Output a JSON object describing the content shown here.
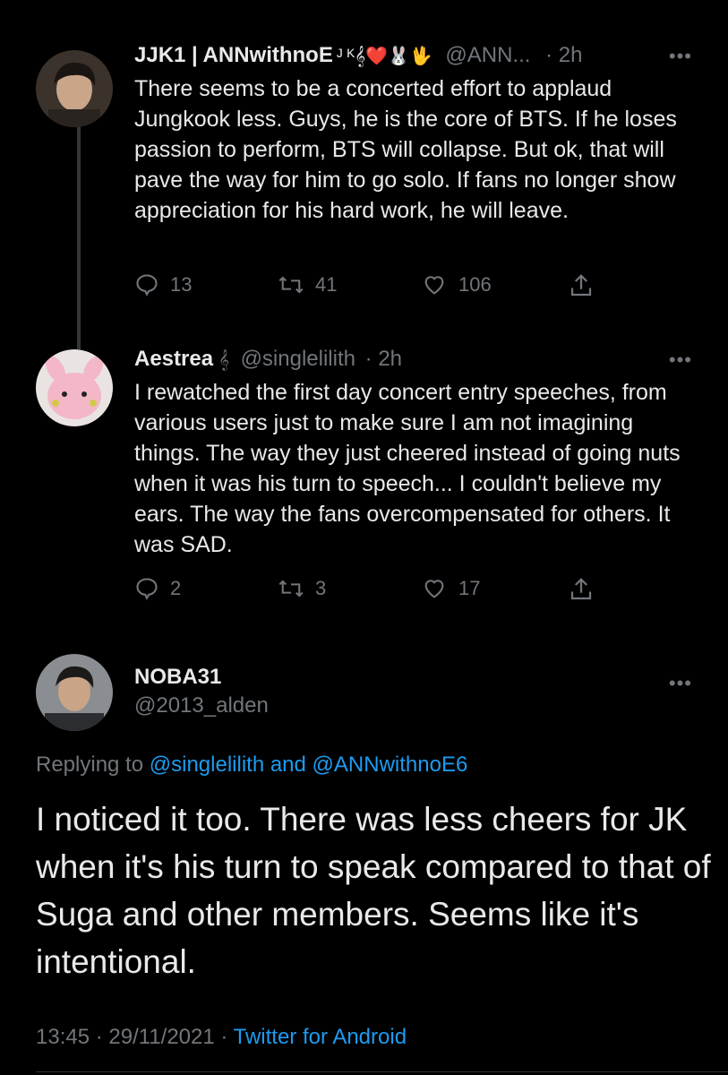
{
  "tweets": [
    {
      "name": "JJK1 | ANNwithnoE",
      "name_suffix": "ᴶ ᴷ𝄞❤️🐰🖖",
      "handle": "@ANN...",
      "time": "· 2h",
      "more": "•••",
      "text": "There seems to be a concerted effort to applaud Jungkook less. Guys, he is the core of BTS. If he loses passion to perform, BTS will collapse. But ok, that will pave the way for him to go solo. If fans no longer show appreciation for his hard work, he will leave.",
      "replies": "13",
      "retweets": "41",
      "likes": "106",
      "avatar_color": "#6b5a48"
    },
    {
      "name": "Aestrea",
      "name_suffix": "𝄞",
      "handle": "@singlelilith",
      "time": "· 2h",
      "more": "•••",
      "text": "I rewatched the first day concert entry speeches, from various users just to make sure I am not imagining things. The way they just cheered instead of going nuts when it was his turn to speech... I couldn't believe my ears. The way the fans overcompensated for others. It was SAD.",
      "replies": "2",
      "retweets": "3",
      "likes": "17",
      "avatar_color": "#f3b7c8"
    }
  ],
  "focal": {
    "name": "NOBA31",
    "handle": "@2013_alden",
    "more": "•••",
    "replying_prefix": "Replying to",
    "replying_to": "@singlelilith and @ANNwithnoE6",
    "text": "I noticed it too. There was less cheers for JK when it's his turn to speak compared to that of Suga and other members. Seems like it's  intentional.",
    "timestamp": "13:45 · 29/11/2021 ·",
    "client": "Twitter for Android",
    "avatar_color": "#4a4f55"
  },
  "colors": {
    "background": "#000000",
    "text": "#e7e9ea",
    "muted": "#71767b",
    "link": "#1d9bf0"
  }
}
